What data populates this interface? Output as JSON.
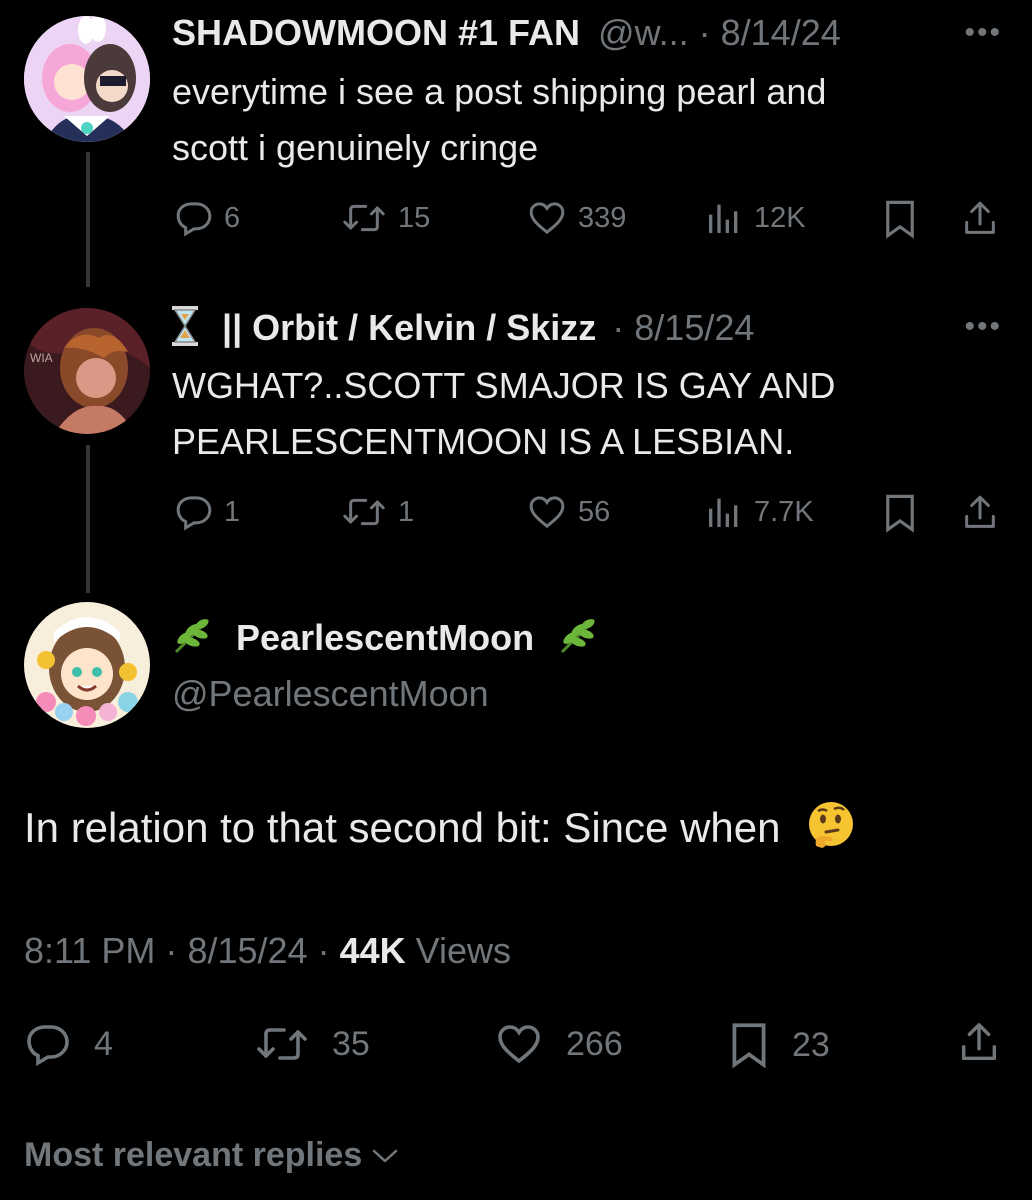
{
  "tweets": [
    {
      "display_name": "SHADOWMOON #1 FAN",
      "handle": "@w...",
      "sep": "·",
      "date": "8/14/24",
      "text_lines": [
        "everytime i see a post shipping pearl and",
        "scott i genuinely cringe"
      ],
      "replies": "6",
      "reposts": "15",
      "likes": "339",
      "views": "12K"
    },
    {
      "display_name": "|| Orbit / Kelvin / Skizz",
      "sep": "·",
      "date": "8/15/24",
      "text_lines": [
        "WGHAT?..SCOTT SMAJOR IS GAY AND",
        "PEARLESCENTMOON IS A LESBIAN."
      ],
      "replies": "1",
      "reposts": "1",
      "likes": "56",
      "views": "7.7K"
    }
  ],
  "main": {
    "display_name": "PearlescentMoon",
    "handle": "@PearlescentMoon",
    "text": "In relation to that second bit: Since when",
    "time": "8:11 PM",
    "date": "8/15/24",
    "sep": "·",
    "views_count": "44K",
    "views_label": "Views",
    "replies": "4",
    "reposts": "35",
    "likes": "266",
    "bookmarks": "23"
  },
  "footer": {
    "sort_label": "Most relevant replies"
  },
  "icons": {
    "reply": "reply-icon",
    "repost": "repost-icon",
    "like": "heart-icon",
    "views": "views-icon",
    "bookmark": "bookmark-icon",
    "share": "share-icon",
    "more": "more-icon"
  },
  "colors": {
    "background": "#000000",
    "text": "#e7e9ea",
    "muted": "#71767b",
    "line": "#333639"
  }
}
